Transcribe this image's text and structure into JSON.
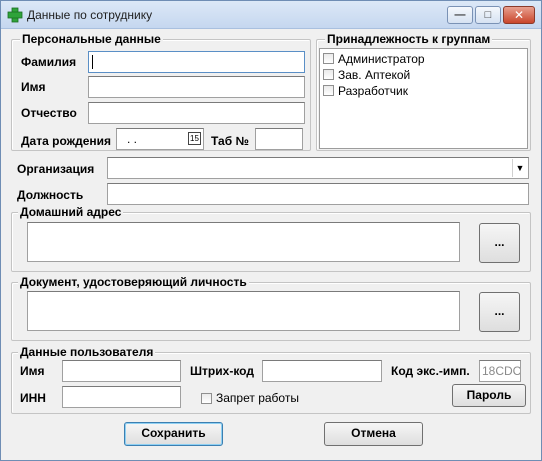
{
  "window": {
    "title": "Данные по сотруднику",
    "minimize": "—",
    "maximize": "□",
    "close": "✕"
  },
  "personal": {
    "legend": "Персональные данные",
    "surname_label": "Фамилия",
    "surname_value": "",
    "name_label": "Имя",
    "name_value": "",
    "patronymic_label": "Отчество",
    "patronymic_value": "",
    "birthdate_label": "Дата рождения",
    "birthdate_value": ". .",
    "calendar_glyph": "15",
    "tab_label": "Таб №",
    "tab_value": ""
  },
  "groups": {
    "legend": "Принадлежность к группам",
    "items": [
      {
        "label": "Администратор",
        "checked": false
      },
      {
        "label": "Зав. Аптекой",
        "checked": false
      },
      {
        "label": "Разработчик",
        "checked": false
      }
    ]
  },
  "organization": {
    "label": "Организация",
    "value": ""
  },
  "position": {
    "label": "Должность",
    "value": ""
  },
  "home_address": {
    "legend": "Домашний адрес",
    "value": "",
    "browse": "..."
  },
  "id_document": {
    "legend": "Документ, удостоверяющий личность",
    "value": "",
    "browse": "..."
  },
  "user": {
    "legend": "Данные пользователя",
    "name_label": "Имя",
    "name_value": "",
    "barcode_label": "Штрих-код",
    "barcode_value": "",
    "code_label": "Код экс.-имп.",
    "code_value": "18CDC",
    "inn_label": "ИНН",
    "inn_value": "",
    "ban_label": "Запрет работы",
    "ban_checked": false,
    "password_button": "Пароль"
  },
  "actions": {
    "save": "Сохранить",
    "cancel": "Отмена"
  },
  "colors": {
    "accent": "#3c7fb1",
    "titlebar": "#c5d7ef",
    "close": "#c9462c"
  }
}
